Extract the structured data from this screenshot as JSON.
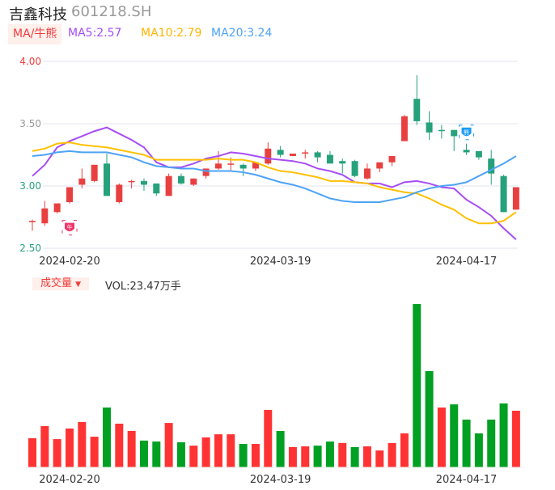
{
  "header": {
    "name": "吉鑫科技",
    "code": "601218.SH"
  },
  "ma_tab": "MA/牛熊",
  "ma_labels": {
    "ma5": "MA5:2.57",
    "ma10": "MA10:2.79",
    "ma20": "MA20:3.24"
  },
  "volume_tab": "成交量",
  "volume_tab_arrow": "▼",
  "volume_label": "VOL:23.47万手",
  "colors": {
    "up": "#e84040",
    "down": "#26a17c",
    "vol_up": "#ff3333",
    "vol_down": "#00a022",
    "ma5": "#a64df5",
    "ma10": "#ffc000",
    "ma20": "#4da3f5"
  },
  "badges": {
    "bull": "牛",
    "bear": "熊"
  },
  "chart_data": [
    {
      "type": "candlestick",
      "title": "吉鑫科技 601218.SH",
      "ylim": [
        2.5,
        4.0
      ],
      "yticks": [
        "4.00",
        "3.50",
        "3.00",
        "2.50"
      ],
      "xtick_labels": [
        {
          "index": 3,
          "label": "2024-02-20"
        },
        {
          "index": 20,
          "label": "2024-03-19"
        },
        {
          "index": 35,
          "label": "2024-04-17"
        }
      ],
      "ohlc": [
        [
          2.71,
          2.73,
          2.64,
          2.72
        ],
        [
          2.7,
          2.88,
          2.68,
          2.82
        ],
        [
          2.79,
          2.86,
          2.78,
          2.86
        ],
        [
          2.87,
          2.99,
          2.86,
          2.99
        ],
        [
          3.01,
          3.14,
          2.98,
          3.06
        ],
        [
          3.04,
          3.17,
          3.03,
          3.17
        ],
        [
          3.18,
          3.26,
          2.92,
          2.92
        ],
        [
          2.87,
          3.02,
          2.86,
          3.01
        ],
        [
          3.03,
          3.05,
          2.98,
          3.04
        ],
        [
          3.04,
          3.06,
          2.96,
          3.01
        ],
        [
          3.02,
          3.02,
          2.92,
          2.94
        ],
        [
          2.92,
          3.1,
          2.92,
          3.08
        ],
        [
          3.08,
          3.1,
          3.01,
          3.02
        ],
        [
          3.01,
          3.06,
          3.0,
          3.06
        ],
        [
          3.08,
          3.14,
          3.06,
          3.14
        ],
        [
          3.14,
          3.28,
          3.13,
          3.18
        ],
        [
          3.18,
          3.23,
          3.12,
          3.18
        ],
        [
          3.17,
          3.18,
          3.08,
          3.14
        ],
        [
          3.14,
          3.19,
          3.12,
          3.19
        ],
        [
          3.18,
          3.35,
          3.17,
          3.3
        ],
        [
          3.29,
          3.32,
          3.23,
          3.25
        ],
        [
          3.24,
          3.26,
          3.24,
          3.26
        ],
        [
          3.27,
          3.29,
          3.22,
          3.27
        ],
        [
          3.27,
          3.28,
          3.19,
          3.23
        ],
        [
          3.25,
          3.28,
          3.18,
          3.18
        ],
        [
          3.2,
          3.22,
          3.1,
          3.18
        ],
        [
          3.2,
          3.21,
          3.07,
          3.08
        ],
        [
          3.06,
          3.18,
          3.05,
          3.14
        ],
        [
          3.14,
          3.19,
          3.11,
          3.19
        ],
        [
          3.19,
          3.24,
          3.16,
          3.24
        ],
        [
          3.36,
          3.57,
          3.36,
          3.56
        ],
        [
          3.7,
          3.89,
          3.49,
          3.52
        ],
        [
          3.51,
          3.6,
          3.37,
          3.43
        ],
        [
          3.45,
          3.49,
          3.38,
          3.44
        ],
        [
          3.45,
          3.45,
          3.28,
          3.4
        ],
        [
          3.29,
          3.34,
          3.25,
          3.27
        ],
        [
          3.28,
          3.28,
          3.21,
          3.23
        ],
        [
          3.22,
          3.29,
          3.01,
          3.1
        ],
        [
          3.08,
          3.09,
          2.79,
          2.79
        ],
        [
          2.81,
          2.99,
          2.81,
          2.99
        ]
      ],
      "series": [
        {
          "name": "MA5",
          "values": [
            3.08,
            3.17,
            3.31,
            3.36,
            3.4,
            3.44,
            3.47,
            3.42,
            3.37,
            3.31,
            3.19,
            3.15,
            3.15,
            3.18,
            3.22,
            3.24,
            3.27,
            3.26,
            3.24,
            3.22,
            3.21,
            3.2,
            3.18,
            3.14,
            3.12,
            3.09,
            3.03,
            3.02,
            3.02,
            2.99,
            3.03,
            3.04,
            3.02,
            2.99,
            2.98,
            2.89,
            2.83,
            2.76,
            2.66,
            2.57
          ]
        },
        {
          "name": "MA10",
          "values": [
            3.28,
            3.3,
            3.34,
            3.35,
            3.33,
            3.32,
            3.31,
            3.29,
            3.27,
            3.25,
            3.21,
            3.21,
            3.21,
            3.21,
            3.21,
            3.22,
            3.21,
            3.21,
            3.19,
            3.15,
            3.12,
            3.11,
            3.09,
            3.07,
            3.04,
            3.04,
            3.03,
            3.02,
            2.99,
            2.97,
            2.95,
            2.94,
            2.9,
            2.85,
            2.81,
            2.74,
            2.7,
            2.7,
            2.72,
            2.79
          ]
        },
        {
          "name": "MA20",
          "values": [
            3.24,
            3.25,
            3.27,
            3.28,
            3.27,
            3.27,
            3.27,
            3.25,
            3.23,
            3.19,
            3.16,
            3.15,
            3.14,
            3.14,
            3.12,
            3.12,
            3.12,
            3.11,
            3.09,
            3.06,
            3.03,
            3.01,
            2.98,
            2.94,
            2.9,
            2.88,
            2.87,
            2.87,
            2.87,
            2.89,
            2.91,
            2.95,
            2.98,
            3.0,
            3.01,
            3.03,
            3.08,
            3.13,
            3.18,
            3.24
          ]
        }
      ],
      "markers": [
        {
          "index": 3,
          "type": "bull",
          "price": 2.71
        },
        {
          "index": 35,
          "type": "bear",
          "price": 3.43
        }
      ]
    },
    {
      "type": "bar",
      "title": "成交量",
      "unit": "万手",
      "ylim": [
        0,
        69.7
      ],
      "xtick_labels": [
        {
          "index": 3,
          "label": "2024-02-20"
        },
        {
          "index": 20,
          "label": "2024-03-19"
        },
        {
          "index": 35,
          "label": "2024-04-17"
        }
      ],
      "values": [
        12.1,
        17.1,
        11.7,
        16.1,
        18.8,
        12.7,
        24.8,
        18.1,
        15.1,
        11.1,
        10.7,
        18.4,
        10.4,
        9.0,
        12.4,
        13.7,
        13.7,
        9.7,
        9.7,
        23.8,
        15.1,
        8.4,
        8.7,
        9.0,
        10.7,
        10.1,
        8.4,
        8.7,
        7.0,
        10.1,
        14.1,
        67.7,
        39.9,
        24.8,
        26.1,
        19.8,
        14.1,
        19.8,
        26.5,
        23.47
      ],
      "up": [
        1,
        1,
        1,
        1,
        1,
        1,
        0,
        1,
        1,
        0,
        0,
        1,
        0,
        1,
        1,
        1,
        1,
        0,
        1,
        1,
        0,
        1,
        1,
        0,
        0,
        1,
        0,
        1,
        1,
        1,
        1,
        0,
        0,
        1,
        0,
        0,
        0,
        0,
        0,
        1
      ]
    }
  ]
}
